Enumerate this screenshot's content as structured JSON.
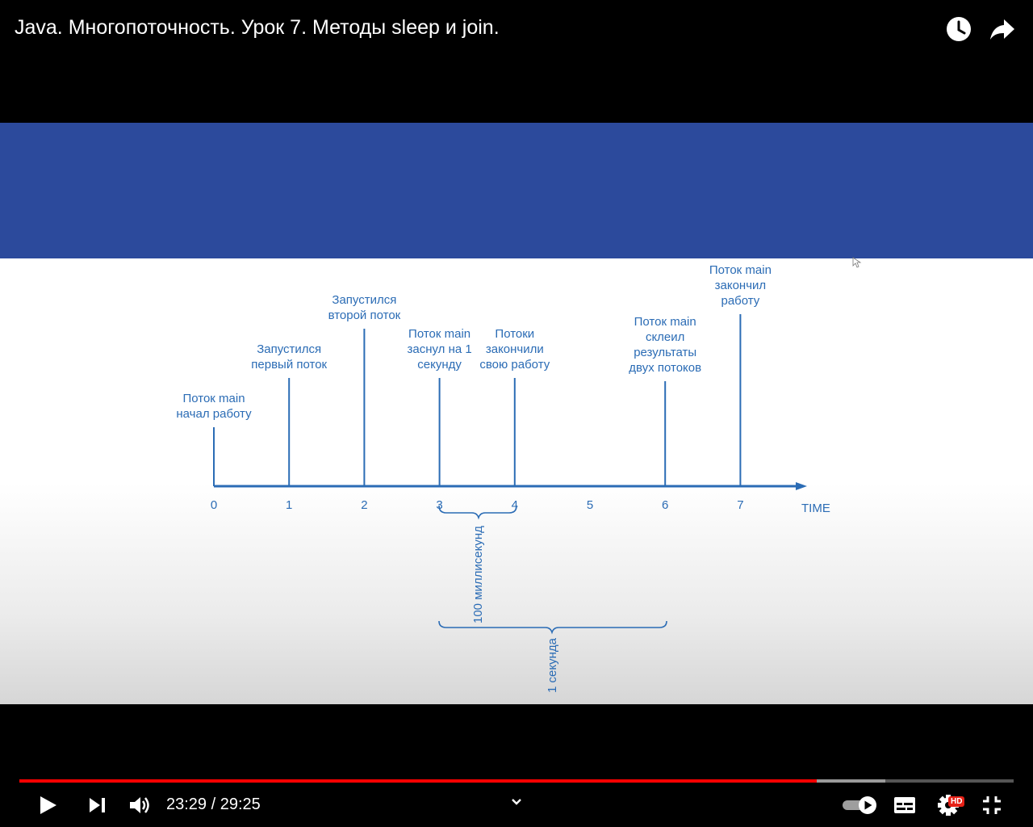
{
  "video": {
    "title": "Java. Многопоточность. Урок 7. Методы sleep и join."
  },
  "top_icons": [
    "clock-icon",
    "share-icon"
  ],
  "diagram": {
    "axis_label": "TIME",
    "ticks": [
      "0",
      "1",
      "2",
      "3",
      "4",
      "5",
      "6",
      "7"
    ],
    "events": [
      {
        "x": 0,
        "lines": [
          "Поток main",
          "начал работу"
        ]
      },
      {
        "x": 1,
        "lines": [
          "Запустился",
          "первый поток"
        ]
      },
      {
        "x": 2,
        "lines": [
          "Запустился",
          "второй поток"
        ]
      },
      {
        "x": 3,
        "lines": [
          "Поток main",
          "заснул на 1",
          "секунду"
        ]
      },
      {
        "x": 4,
        "lines": [
          "Потоки",
          "закончили",
          "свою работу"
        ]
      },
      {
        "x": 6,
        "lines": [
          "Поток main",
          "склеил",
          "результаты",
          "двух потоков"
        ]
      },
      {
        "x": 7,
        "lines": [
          "Поток main",
          "закончил",
          "работу"
        ]
      }
    ],
    "brace_short_label": "100 миллисекунд",
    "brace_long_label": "1 секунда",
    "colors": {
      "diagram": "#2b6cb5",
      "band": "#2c4a9c"
    }
  },
  "player": {
    "time_text": "23:29 / 29:25",
    "progress_fraction": 0.8023,
    "buffered_fraction": 0.8707,
    "hd_badge": "HD",
    "controls": [
      "play-icon",
      "next-icon",
      "volume-icon",
      "chevron-down-icon",
      "autoplay-toggle",
      "subtitles-icon",
      "settings-icon",
      "exit-fullscreen-icon"
    ]
  }
}
